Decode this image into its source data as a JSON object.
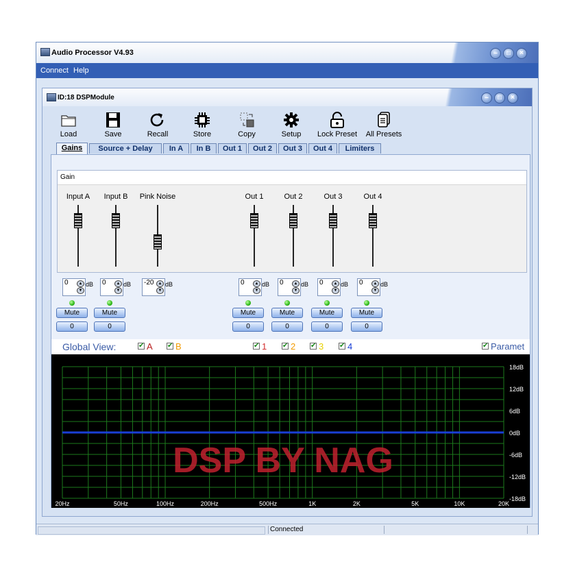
{
  "window": {
    "title": "Audio Processor V4.93"
  },
  "menu": {
    "items": [
      "Connect",
      "Help"
    ]
  },
  "module": {
    "title": "ID:18  DSPModule"
  },
  "toolbar": {
    "items": [
      {
        "label": "Load",
        "icon": "folder-icon"
      },
      {
        "label": "Save",
        "icon": "floppy-disk-icon"
      },
      {
        "label": "Recall",
        "icon": "refresh-icon"
      },
      {
        "label": "Store",
        "icon": "chip-icon"
      },
      {
        "label": "Copy",
        "icon": "copy-icon"
      },
      {
        "label": "Setup",
        "icon": "gear-icon"
      },
      {
        "label": "Lock Preset",
        "icon": "unlock-icon"
      },
      {
        "label": "All Presets",
        "icon": "documents-icon"
      }
    ]
  },
  "tabs": [
    {
      "label": "Gains",
      "active": true
    },
    {
      "label": "Source + Delay"
    },
    {
      "label": "In A"
    },
    {
      "label": "In B"
    },
    {
      "label": "Out 1"
    },
    {
      "label": "Out 2"
    },
    {
      "label": "Out 3"
    },
    {
      "label": "Out 4"
    },
    {
      "label": "Limiters"
    }
  ],
  "gain": {
    "header": "Gain",
    "unit": "dB",
    "mute_label": "Mute",
    "channels": [
      {
        "label": "Input A",
        "value": "0",
        "level": 0.25,
        "mute": true,
        "count": "0"
      },
      {
        "label": "Input B",
        "value": "0",
        "level": 0.25,
        "mute": true,
        "count": "0"
      },
      {
        "label": "Pink Noise",
        "value": "-20",
        "level": 0.6,
        "mute": false
      },
      {
        "label": "Out 1",
        "value": "0",
        "level": 0.25,
        "mute": true,
        "count": "0"
      },
      {
        "label": "Out 2",
        "value": "0",
        "level": 0.25,
        "mute": true,
        "count": "0"
      },
      {
        "label": "Out 3",
        "value": "0",
        "level": 0.25,
        "mute": true,
        "count": "0"
      },
      {
        "label": "Out 4",
        "value": "0",
        "level": 0.25,
        "mute": true,
        "count": "0"
      }
    ]
  },
  "global_view": {
    "label": "Global View:",
    "checks": [
      {
        "label": "A",
        "color": "#b71c1c",
        "checked": true
      },
      {
        "label": "B",
        "color": "#f29a00",
        "checked": true
      },
      {
        "label": "1",
        "color": "#d32f2f",
        "checked": true
      },
      {
        "label": "2",
        "color": "#f29a00",
        "checked": true
      },
      {
        "label": "3",
        "color": "#e8d000",
        "checked": true
      },
      {
        "label": "4",
        "color": "#1a3fd6",
        "checked": true
      }
    ],
    "param_label": "Paramet"
  },
  "graph": {
    "x_ticks": [
      "20Hz",
      "50Hz",
      "100Hz",
      "200Hz",
      "500Hz",
      "1K",
      "2K",
      "5K",
      "10K",
      "20K"
    ],
    "y_ticks": [
      "18dB",
      "12dB",
      "6dB",
      "0dB",
      "-6dB",
      "-12dB",
      "-18dB"
    ],
    "watermark": "DSP BY NAG",
    "line_color": "#1a3fd6",
    "grid_color": "#1d7a1d"
  },
  "status": {
    "text": "Connected"
  }
}
